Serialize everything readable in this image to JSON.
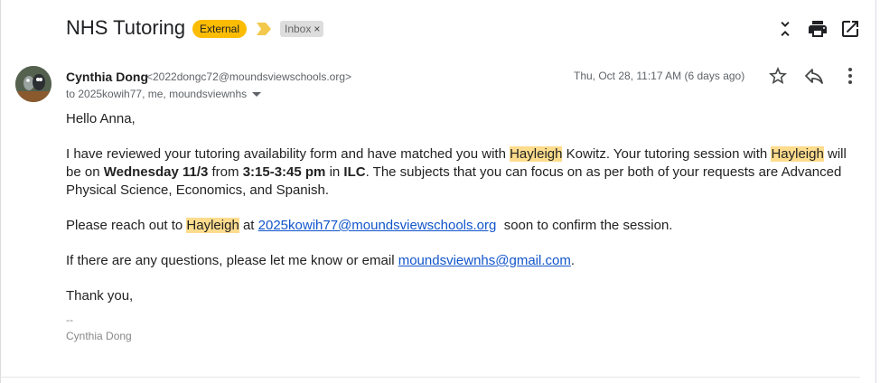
{
  "thread": {
    "subject": "NHS Tutoring",
    "labels": {
      "external": "External",
      "inbox": "Inbox",
      "remove_glyph": "×"
    },
    "actions": {
      "collapse_icon": "unfold-less-icon",
      "print_icon": "print-icon",
      "open_new_window_icon": "open-in-new-icon"
    }
  },
  "message": {
    "sender_name": "Cynthia Dong",
    "sender_email": "<2022dongc72@moundsviewschools.org>",
    "recipients": "to 2025kowih77, me, moundsviewnhs",
    "date": "Thu, Oct 28, 11:17 AM (6 days ago)",
    "actions": {
      "star_icon": "star-icon",
      "reply_icon": "reply-icon",
      "more_icon": "more-vert-icon"
    },
    "body": {
      "greeting": "Hello Anna,",
      "p1": {
        "t1": "I have reviewed your tutoring availability form and have matched you with ",
        "name1": "Hayleigh",
        "t2": " Kowitz. Your tutoring session with ",
        "name2": "Hayleigh",
        "t3": " will be on ",
        "day": "Wednesday 11/3",
        "t4": " from ",
        "time": "3:15-3:45 pm",
        "t5": " in ",
        "place": "ILC",
        "t6": ". The subjects that you can focus on as per both of your requests are Advanced Physical Science, Economics, and Spanish."
      },
      "p2": {
        "t1": "Please reach out to ",
        "name": "Hayleigh",
        "t2": " at ",
        "email": "2025kowih77@moundsviewschools.org",
        "t3": "  soon to confirm the session."
      },
      "p3": {
        "t1": "If there are any questions, please let me know or email ",
        "email": "moundsviewnhs@gmail.com",
        "t2": "."
      },
      "closing": "Thank you,",
      "sig_dash": "--",
      "sig_name": "Cynthia Dong"
    }
  },
  "colors": {
    "external_label": "#fbbc04",
    "highlight": "#fddc8d",
    "link": "#1155cc"
  }
}
